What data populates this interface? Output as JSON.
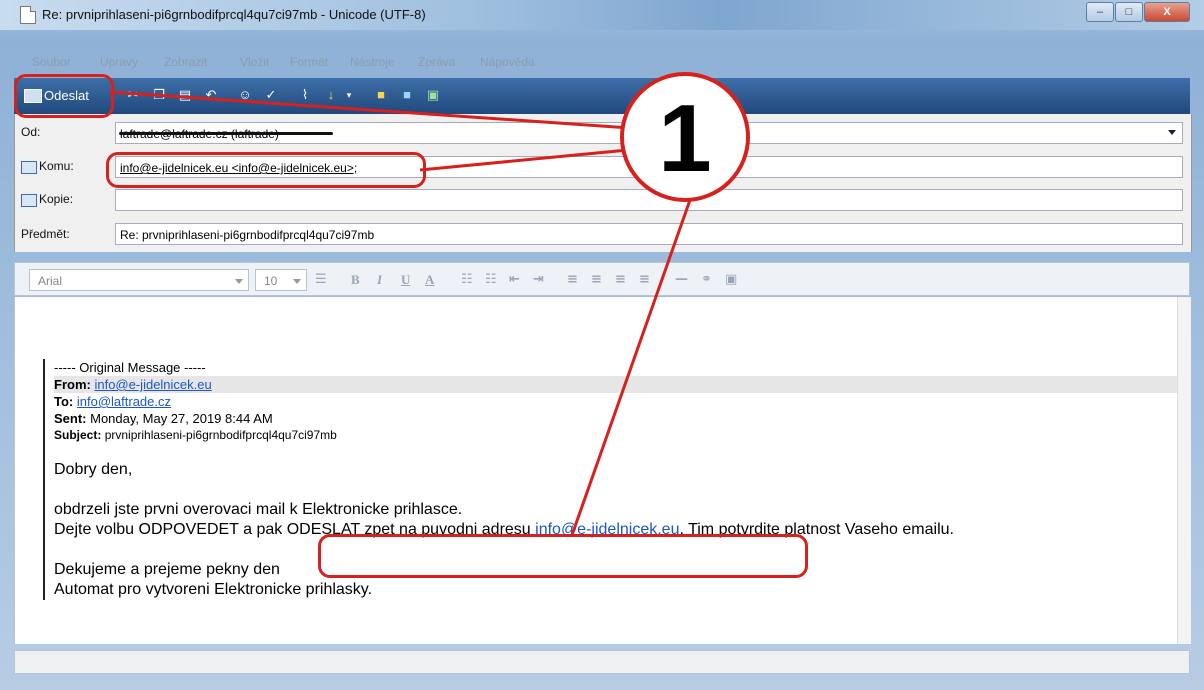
{
  "window": {
    "title": "Re: prvniprihlaseni-pi6grnbodifprcql4qu7ci97mb - Unicode (UTF-8)",
    "minimize_symbol": "–",
    "maximize_symbol": "□",
    "close_symbol": "X"
  },
  "menu": [
    "Soubor",
    "Úpravy",
    "Zobrazit",
    "Vložit",
    "Formát",
    "Nástroje",
    "Zpráva",
    "Nápověda"
  ],
  "toolbar": {
    "send_label": "Odeslat",
    "icons": [
      "cut-icon",
      "copy-icon",
      "paste-icon",
      "undo-icon",
      "check-names-icon",
      "spelling-icon",
      "attach-icon",
      "priority-icon",
      "sign-icon",
      "encrypt-icon",
      "offline-icon"
    ]
  },
  "header": {
    "from_label": "Od:",
    "from_value": "laftrade@laftrade.cz   (laftrade)",
    "to_label": "Komu:",
    "to_value": "info@e-jidelnicek.eu <info@e-jidelnicek.eu>;",
    "cc_label": "Kopie:",
    "cc_value": "",
    "subject_label": "Předmět:",
    "subject_value": "Re: prvniprihlaseni-pi6grnbodifprcql4qu7ci97mb"
  },
  "format": {
    "font": "Arial",
    "size": "10",
    "buttons": [
      "B",
      "I",
      "U",
      "A"
    ]
  },
  "message": {
    "original_header": "----- Original Message -----",
    "from_label": "From:",
    "from_value": "info@e-jidelnicek.eu",
    "to_label": "To:",
    "to_value": "info@laftrade.cz",
    "sent_label": "Sent:",
    "sent_value": "Monday, May 27, 2019 8:44 AM",
    "subject_label": "Subject:",
    "subject_value": "prvniprihlaseni-pi6grnbodifprcql4qu7ci97mb",
    "greeting": "Dobry den,",
    "line1": "obdrzeli jste prvni overovaci mail k Elektronicke prihlasce.",
    "line2_a": "Dejte volbu ODPOVEDET a pak ODESLAT zpet na puvodni adresu ",
    "line2_link": "info@e-jidelnicek.eu",
    "line2_b": ". Tim potvrdite platnost Vaseho emailu.",
    "closing1": "Dekujeme a prejeme pekny den",
    "closing2": "Automat pro vytvoreni Elektronicke prihlasky."
  },
  "annotation": {
    "number": "1",
    "color": "#d6211c"
  }
}
